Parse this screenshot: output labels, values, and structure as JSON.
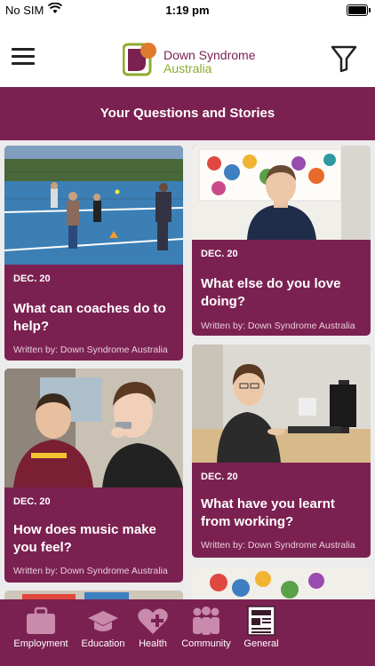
{
  "status_bar": {
    "carrier": "No SIM",
    "time": "1:19 pm"
  },
  "header": {
    "logo_line1": "Down Syndrome",
    "logo_line2": "Australia"
  },
  "banner": {
    "title": "Your Questions and Stories"
  },
  "cards": [
    {
      "date": "DEC. 20",
      "title": "What can coaches do to help?",
      "author": "Written by: Down Syndrome Australia",
      "image": "tennis-coaching-photo"
    },
    {
      "date": "DEC. 20",
      "title": "What else do you love doing?",
      "author": "Written by: Down Syndrome Australia",
      "image": "man-in-front-of-handprint-art-photo"
    },
    {
      "date": "DEC. 20",
      "title": "How does music make you feel?",
      "author": "Written by: Down Syndrome Australia",
      "image": "music-harmonica-photo"
    },
    {
      "date": "DEC. 20",
      "title": "What have you learnt from working?",
      "author": "Written by: Down Syndrome Australia",
      "image": "woman-at-office-desk-photo"
    }
  ],
  "tabs": [
    {
      "label": "Employment",
      "icon": "briefcase-icon"
    },
    {
      "label": "Education",
      "icon": "graduation-cap-icon"
    },
    {
      "label": "Health",
      "icon": "heart-plus-icon"
    },
    {
      "label": "Community",
      "icon": "people-group-icon"
    },
    {
      "label": "General",
      "icon": "newspaper-icon"
    }
  ],
  "colors": {
    "primary": "#7b2151",
    "accent_green": "#8dab2e",
    "background": "#ececec"
  }
}
